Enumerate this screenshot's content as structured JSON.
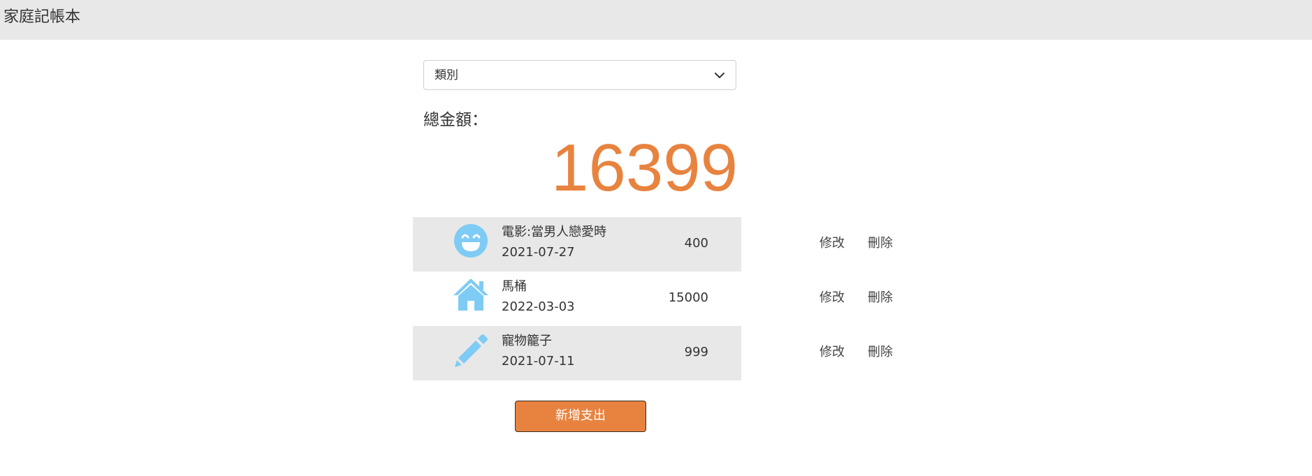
{
  "header": {
    "title": "家庭記帳本"
  },
  "filter": {
    "selected": "類別",
    "icon": "chevron-down-icon"
  },
  "summary": {
    "label": "總金額：",
    "total": "16399",
    "color": "#e8833f"
  },
  "expenses": [
    {
      "icon": "smile-icon",
      "name": "電影:當男人戀愛時",
      "date": "2021-07-27",
      "amount": "400",
      "edit_label": "修改",
      "delete_label": "刪除"
    },
    {
      "icon": "home-icon",
      "name": "馬桶",
      "date": "2022-03-03",
      "amount": "15000",
      "edit_label": "修改",
      "delete_label": "刪除"
    },
    {
      "icon": "pencil-icon",
      "name": "寵物籠子",
      "date": "2021-07-11",
      "amount": "999",
      "edit_label": "修改",
      "delete_label": "刪除"
    }
  ],
  "actions": {
    "add_label": "新增支出"
  },
  "colors": {
    "accent": "#e8833f",
    "icon": "#7ecbf5",
    "stripe": "#e8e8e8"
  }
}
